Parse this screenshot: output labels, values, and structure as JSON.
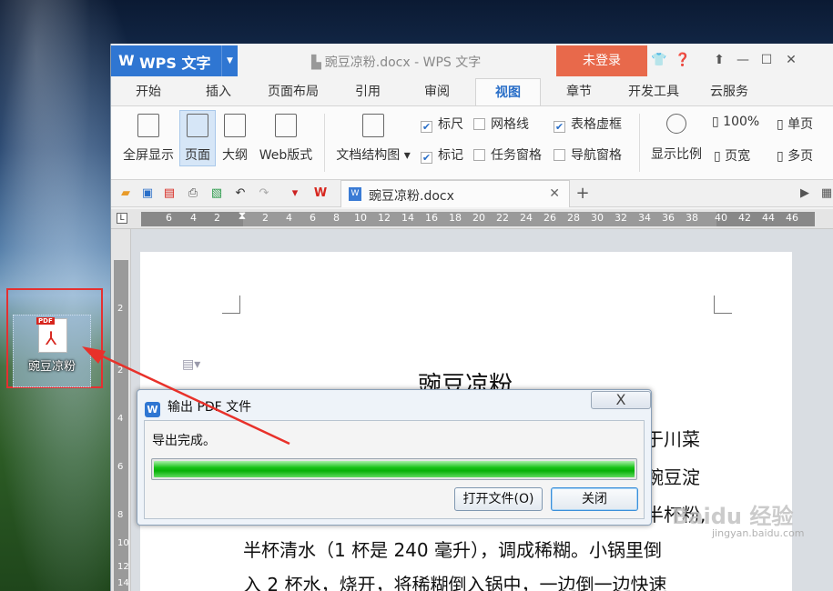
{
  "desktop": {
    "icon_label": "豌豆凉粉",
    "pdf_tag": "PDF"
  },
  "app": {
    "logo": "W",
    "name": "WPS 文字",
    "window_title": "豌豆凉粉.docx - WPS 文字",
    "login_label": "未登录"
  },
  "menu_tabs": [
    "开始",
    "插入",
    "页面布局",
    "引用",
    "审阅",
    "视图",
    "章节",
    "开发工具",
    "云服务"
  ],
  "ribbon": {
    "fullscreen": "全屏显示",
    "page": "页面",
    "outline": "大纲",
    "web": "Web版式",
    "doc_structure": "文档结构图",
    "ruler": "标尺",
    "gridlines": "网格线",
    "table_gridlines": "表格虚框",
    "marks": "标记",
    "task_pane": "任务窗格",
    "nav_pane": "导航窗格",
    "zoom": "显示比例",
    "zoom_value": "100%",
    "page_width": "页宽",
    "single_page": "单页",
    "multi_page": "多页"
  },
  "quickbar": {
    "doc_tab_name": "豌豆凉粉.docx"
  },
  "ruler_numbers": [
    "6",
    "4",
    "2",
    "2",
    "4",
    "6",
    "8",
    "10",
    "12",
    "14",
    "16",
    "18",
    "20",
    "22",
    "24",
    "26",
    "28",
    "30",
    "32",
    "34",
    "36",
    "38",
    "40",
    "42",
    "44",
    "46"
  ],
  "vruler_numbers": [
    "2",
    "2",
    "4",
    "6",
    "8",
    "10",
    "12",
    "14"
  ],
  "document": {
    "heading": "豌豆凉粉",
    "line1_tail": "于川菜",
    "line2_tail": "豌豆淀",
    "line3_tail": "半杯粉,",
    "line4": "半杯清水（1 杯是 240 毫升），调成稀糊。小锅里倒",
    "line5": "入 2 杯水，烧开，将稀糊倒入锅中，一边倒一边快速"
  },
  "watermark": {
    "brand": "Baidu 经验",
    "url": "jingyan.baidu.com"
  },
  "dialog": {
    "logo": "W",
    "title": "输出 PDF 文件",
    "close_symbol": "X",
    "message": "导出完成。",
    "progress_percent": 100,
    "open_file": "打开文件(O)",
    "close": "关闭"
  }
}
